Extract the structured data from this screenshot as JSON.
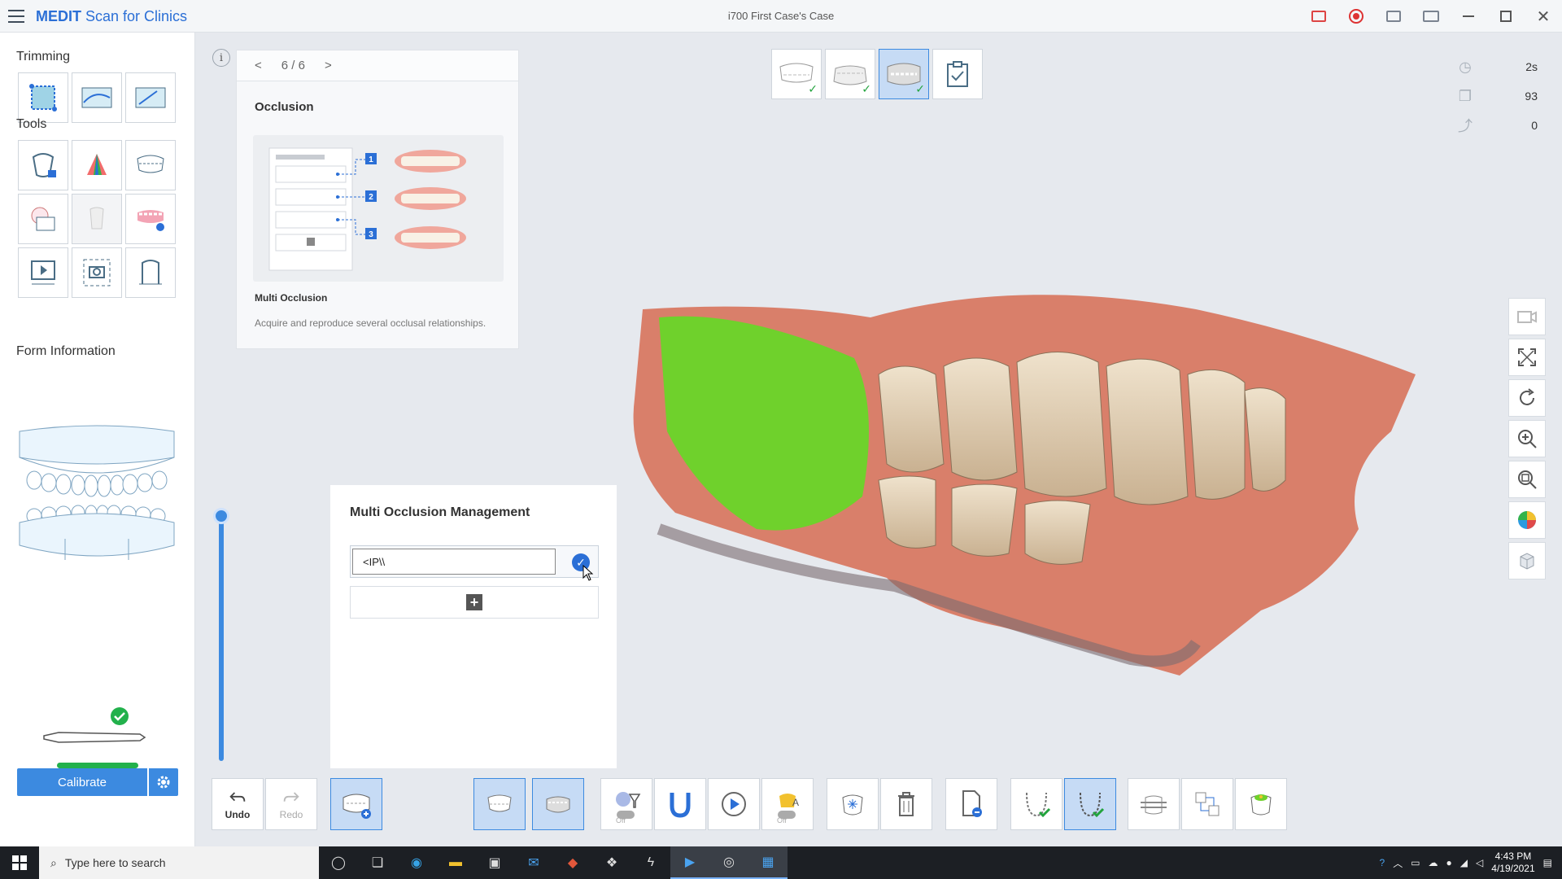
{
  "titlebar": {
    "app_brand": "MEDIT",
    "app_name": "Scan for Clinics",
    "case_title": "i700 First Case's Case"
  },
  "left_panel": {
    "trimming_title": "Trimming",
    "tools_title": "Tools",
    "form_info_title": "Form Information",
    "calibrate_label": "Calibrate"
  },
  "guide": {
    "page": "6 / 6",
    "title": "Occlusion",
    "subtitle": "Multi Occlusion",
    "description": "Acquire and reproduce several occlusal relationships.",
    "steps": [
      "1",
      "2",
      "3"
    ]
  },
  "info_label": "i",
  "stats": {
    "time": "2s",
    "count": "93",
    "other": "0"
  },
  "multi_occlusion": {
    "title": "Multi Occlusion Management",
    "input_value": "<IP\\\\"
  },
  "bottom": {
    "undo_label": "Undo",
    "redo_label": "Redo",
    "off_label": "Off"
  },
  "taskbar": {
    "search_placeholder": "Type here to search",
    "time": "4:43 PM",
    "date": "4/19/2021"
  },
  "colors": {
    "accent": "#3c8ae0",
    "brand": "#2b6fd6",
    "success": "#22b14c"
  }
}
